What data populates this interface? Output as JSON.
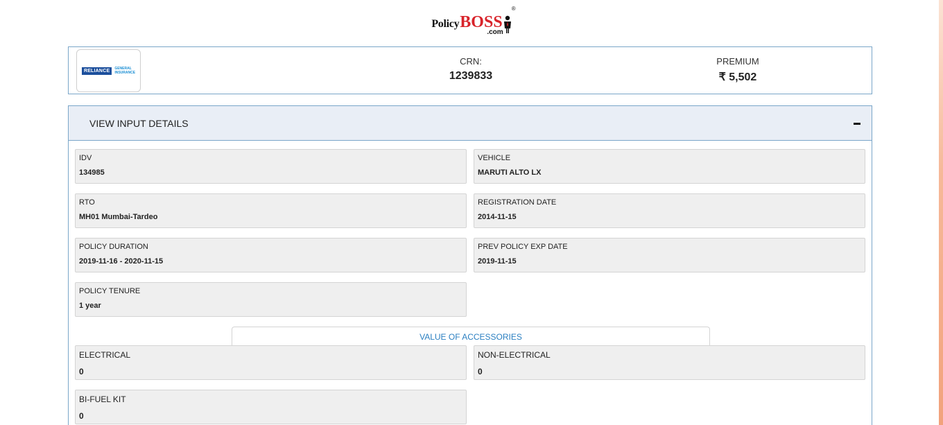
{
  "brand": {
    "policy": "Policy",
    "boss": "BOSS",
    "dotcom": ".com",
    "reg": "®"
  },
  "header": {
    "insurer_logo": {
      "main": "RELIANCE",
      "sub_line1": "GENERAL",
      "sub_line2": "INSURANCE"
    },
    "crn_label": "CRN:",
    "crn_value": "1239833",
    "premium_label": "PREMIUM",
    "premium_value": "₹ 5,502"
  },
  "details": {
    "title": "VIEW INPUT DETAILS",
    "collapse_icon": "minus-icon",
    "fields": [
      {
        "label": "IDV",
        "value": "134985"
      },
      {
        "label": "VEHICLE",
        "value": "MARUTI ALTO LX"
      },
      {
        "label": "RTO",
        "value": "MH01 Mumbai-Tardeo"
      },
      {
        "label": "REGISTRATION DATE",
        "value": "2014-11-15"
      },
      {
        "label": "POLICY DURATION",
        "value": "2019-11-16 - 2020-11-15"
      },
      {
        "label": "PREV POLICY EXP DATE",
        "value": "2019-11-15"
      },
      {
        "label": "POLICY TENURE",
        "value": "1 year"
      }
    ],
    "accessories_title": "VALUE OF ACCESSORIES",
    "accessories": [
      {
        "label": "ELECTRICAL",
        "value": "0"
      },
      {
        "label": "NON-ELECTRICAL",
        "value": "0"
      },
      {
        "label": "BI-FUEL KIT",
        "value": "0"
      }
    ]
  },
  "colors": {
    "accent_border": "#7aa6c9",
    "header_bg": "#e9eef6",
    "brand_red": "#d8232a",
    "link_blue": "#2a7fc1"
  }
}
